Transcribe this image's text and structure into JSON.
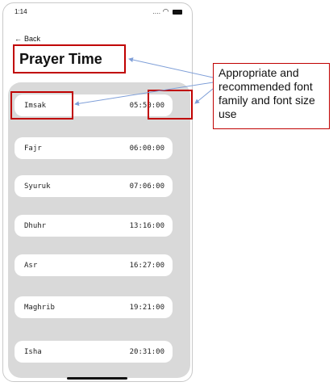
{
  "status_bar": {
    "time": "1:14",
    "dots": "....",
    "wifi_icon": "wifi-icon",
    "battery_icon": "battery-icon"
  },
  "nav": {
    "back_label": "Back"
  },
  "page": {
    "title": "Prayer Time"
  },
  "prayers": [
    {
      "name": "Imsak",
      "time": "05:50:00"
    },
    {
      "name": "Fajr",
      "time": "06:00:00"
    },
    {
      "name": "Syuruk",
      "time": "07:06:00"
    },
    {
      "name": "Dhuhr",
      "time": "13:16:00"
    },
    {
      "name": "Asr",
      "time": "16:27:00"
    },
    {
      "name": "Maghrib",
      "time": "19:21:00"
    },
    {
      "name": "Isha",
      "time": "20:31:00"
    }
  ],
  "annotation": {
    "text": "Appropriate and recommended font family and font size use",
    "highlight_color": "#c00000",
    "arrow_color": "#7f9fd8"
  }
}
